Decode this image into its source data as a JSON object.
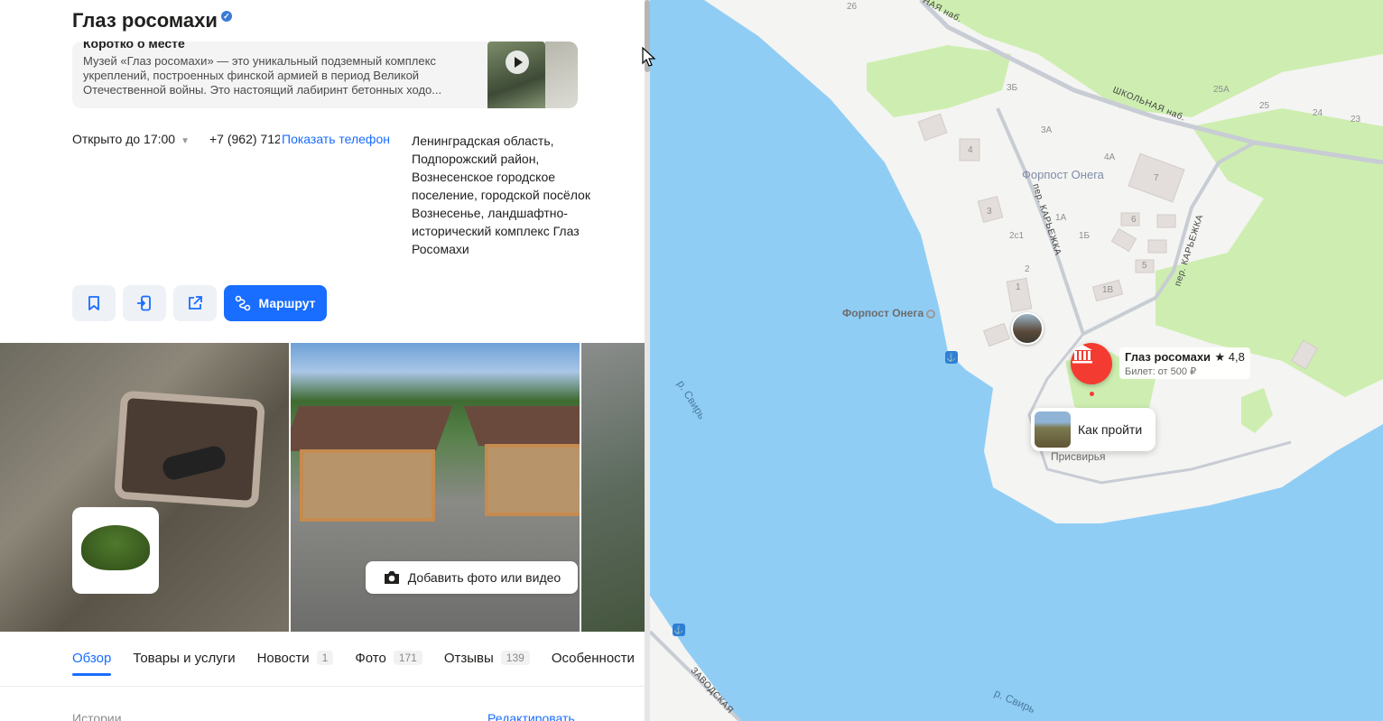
{
  "place": {
    "title": "Глаз росомахи",
    "about_heading": "Коротко о месте",
    "about_text": "Музей «Глаз росомахи» — это уникальный подземный комплекс укреплений, построенных финской армией в период Великой Отечественной войны. Это настоящий лабиринт бетонных ходо...",
    "hours": "Открыто до 17:00",
    "phone": "+7 (962) 712",
    "show_phone": "Показать телефон",
    "address": "Ленинградская область, Подпорожский район, Вознесенское городское поселение, городской посёлок Вознесенье, ландшафтно-исторический комплекс Глаз Росомахи"
  },
  "actions": {
    "route_label": "Маршрут",
    "bookmark_icon": "bookmark-icon",
    "send_icon": "send-to-phone-icon",
    "share_icon": "share-icon"
  },
  "photos": {
    "add_label": "Добавить фото или видео"
  },
  "tabs": [
    {
      "label": "Обзор",
      "count": ""
    },
    {
      "label": "Товары и услуги",
      "count": ""
    },
    {
      "label": "Новости",
      "count": "1"
    },
    {
      "label": "Фото",
      "count": "171"
    },
    {
      "label": "Отзывы",
      "count": "139"
    },
    {
      "label": "Особенности",
      "count": ""
    }
  ],
  "section": {
    "stories": "Истории",
    "edit": "Редактировать"
  },
  "map": {
    "poi_name": "Глаз росомахи",
    "poi_rating": "★ 4,8",
    "poi_ticket": "Билет: от 500 ₽",
    "how_to": "Как пройти",
    "place_label": "Форпост Онега",
    "place_label_2": "Форпост Онега",
    "village": "Присвирья",
    "river_1": "р. Свирь",
    "river_2": "р. Свирь",
    "streets": {
      "embankment": "ШКОЛЬНАЯ наб.",
      "top_embankment": "НАЯ наб.",
      "lane_1": "пер. КАРЬЕЖКА",
      "lane_2": "пер. КАРЬЕЖКА",
      "factory": "ЗАВОДСКАЯ"
    },
    "house_numbers": [
      "26",
      "3Б",
      "3А",
      "4",
      "4А",
      "7",
      "3",
      "1А",
      "1Б",
      "6",
      "2с1",
      "2",
      "5",
      "1",
      "1В",
      "25А",
      "25",
      "24",
      "23"
    ]
  },
  "colors": {
    "accent": "#196dff",
    "poi": "#f43b31",
    "water": "#90cdf5",
    "land": "#f4f4f2",
    "green": "#cdeeb0"
  }
}
